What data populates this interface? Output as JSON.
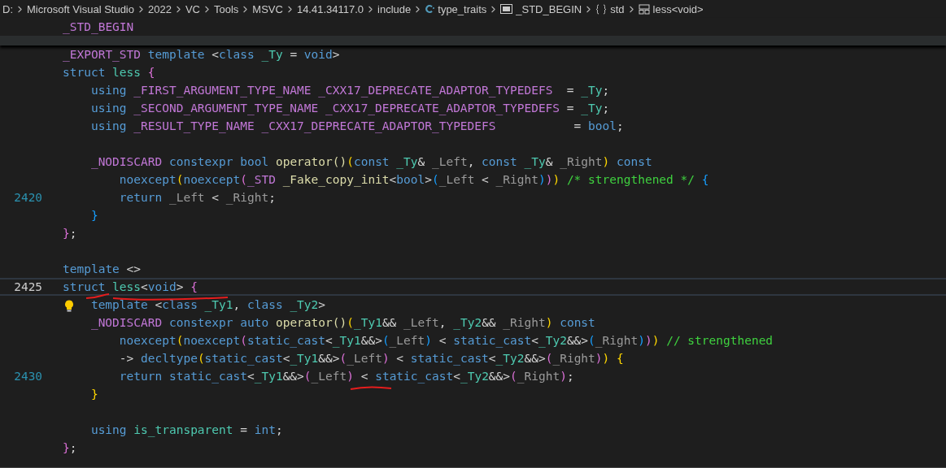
{
  "breadcrumb": [
    {
      "kind": "folder",
      "label": "D:"
    },
    {
      "kind": "folder",
      "label": "Microsoft Visual Studio"
    },
    {
      "kind": "folder",
      "label": "2022"
    },
    {
      "kind": "folder",
      "label": "VC"
    },
    {
      "kind": "folder",
      "label": "Tools"
    },
    {
      "kind": "folder",
      "label": "MSVC"
    },
    {
      "kind": "folder",
      "label": "14.41.34117.0"
    },
    {
      "kind": "folder",
      "label": "include"
    },
    {
      "kind": "file",
      "label": "type_traits"
    },
    {
      "kind": "macro",
      "label": "_STD_BEGIN"
    },
    {
      "kind": "namespace",
      "label": "std"
    },
    {
      "kind": "struct",
      "label": "less<void>"
    }
  ],
  "sticky_lines": [
    {
      "tokens": [
        {
          "kind": "macro",
          "text": "_STD_BEGIN"
        }
      ]
    }
  ],
  "lines": [
    {
      "current": false,
      "tokens": [
        {
          "kind": "macro",
          "text": "_EXPORT_STD"
        },
        {
          "kind": "kw",
          "text": " template"
        },
        {
          "kind": "plain",
          "text": " <"
        },
        {
          "kind": "kw",
          "text": "class"
        },
        {
          "kind": "type",
          "text": " _Ty"
        },
        {
          "kind": "plain",
          "text": " ="
        },
        {
          "kind": "kw",
          "text": " void"
        },
        {
          "kind": "plain",
          "text": ">"
        }
      ]
    },
    {
      "current": false,
      "tokens": [
        {
          "kind": "kw",
          "text": "struct"
        },
        {
          "kind": "type",
          "text": " less"
        },
        {
          "kind": "b2",
          "text": " {"
        }
      ]
    },
    {
      "current": false,
      "tokens": [
        {
          "kind": "kw",
          "text": "    using"
        },
        {
          "kind": "macro",
          "text": " _FIRST_ARGUMENT_TYPE_NAME"
        },
        {
          "kind": "macro",
          "text": " _CXX17_DEPRECATE_ADAPTOR_TYPEDEFS"
        },
        {
          "kind": "plain",
          "text": "  ="
        },
        {
          "kind": "type",
          "text": " _Ty"
        },
        {
          "kind": "plain",
          "text": ";"
        }
      ]
    },
    {
      "current": false,
      "tokens": [
        {
          "kind": "kw",
          "text": "    using"
        },
        {
          "kind": "macro",
          "text": " _SECOND_ARGUMENT_TYPE_NAME"
        },
        {
          "kind": "macro",
          "text": " _CXX17_DEPRECATE_ADAPTOR_TYPEDEFS"
        },
        {
          "kind": "plain",
          "text": " ="
        },
        {
          "kind": "type",
          "text": " _Ty"
        },
        {
          "kind": "plain",
          "text": ";"
        }
      ]
    },
    {
      "current": false,
      "tokens": [
        {
          "kind": "kw",
          "text": "    using"
        },
        {
          "kind": "macro",
          "text": " _RESULT_TYPE_NAME"
        },
        {
          "kind": "macro",
          "text": " _CXX17_DEPRECATE_ADAPTOR_TYPEDEFS"
        },
        {
          "kind": "plain",
          "text": "           ="
        },
        {
          "kind": "kw",
          "text": " bool"
        },
        {
          "kind": "plain",
          "text": ";"
        }
      ]
    },
    {
      "current": false
    },
    {
      "current": false,
      "tokens": [
        {
          "kind": "macro",
          "text": "    _NODISCARD"
        },
        {
          "kind": "kw",
          "text": " constexpr"
        },
        {
          "kind": "kw",
          "text": " bool"
        },
        {
          "kind": "fn",
          "text": " operator()"
        },
        {
          "kind": "b1",
          "text": "("
        },
        {
          "kind": "kw",
          "text": "const"
        },
        {
          "kind": "type",
          "text": " _Ty"
        },
        {
          "kind": "plain",
          "text": "&"
        },
        {
          "kind": "param",
          "text": " _Left"
        },
        {
          "kind": "plain",
          "text": ","
        },
        {
          "kind": "kw",
          "text": " const"
        },
        {
          "kind": "type",
          "text": " _Ty"
        },
        {
          "kind": "plain",
          "text": "&"
        },
        {
          "kind": "param",
          "text": " _Right"
        },
        {
          "kind": "b1",
          "text": ")"
        },
        {
          "kind": "kw",
          "text": " const"
        }
      ]
    },
    {
      "current": false,
      "tokens": [
        {
          "kind": "kw",
          "text": "        noexcept"
        },
        {
          "kind": "b1",
          "text": "("
        },
        {
          "kind": "kw",
          "text": "noexcept"
        },
        {
          "kind": "b2",
          "text": "("
        },
        {
          "kind": "macro",
          "text": "_STD"
        },
        {
          "kind": "fn",
          "text": " _Fake_copy_init"
        },
        {
          "kind": "plain",
          "text": "<"
        },
        {
          "kind": "kw",
          "text": "bool"
        },
        {
          "kind": "plain",
          "text": ">"
        },
        {
          "kind": "b3",
          "text": "("
        },
        {
          "kind": "param",
          "text": "_Left"
        },
        {
          "kind": "plain",
          "text": " <"
        },
        {
          "kind": "param",
          "text": " _Right"
        },
        {
          "kind": "b3",
          "text": ")"
        },
        {
          "kind": "b2",
          "text": ")"
        },
        {
          "kind": "b1",
          "text": ")"
        },
        {
          "kind": "comment",
          "text": " /* strengthened */"
        },
        {
          "kind": "b3",
          "text": " {"
        }
      ]
    },
    {
      "current": false,
      "number": "2420",
      "tokens": [
        {
          "kind": "kw",
          "text": "        return"
        },
        {
          "kind": "param",
          "text": " _Left"
        },
        {
          "kind": "plain",
          "text": " <"
        },
        {
          "kind": "param",
          "text": " _Right"
        },
        {
          "kind": "plain",
          "text": ";"
        }
      ]
    },
    {
      "current": false,
      "tokens": [
        {
          "kind": "b3",
          "text": "    }"
        }
      ]
    },
    {
      "current": false,
      "tokens": [
        {
          "kind": "b2",
          "text": "}"
        },
        {
          "kind": "plain",
          "text": ";"
        }
      ]
    },
    {
      "current": false
    },
    {
      "current": false,
      "tokens": [
        {
          "kind": "kw",
          "text": "template"
        },
        {
          "kind": "plain",
          "text": " <>"
        }
      ]
    },
    {
      "current": true,
      "number": "2425",
      "tokens": [
        {
          "kind": "kw",
          "text": "struct"
        },
        {
          "kind": "type",
          "text": " less"
        },
        {
          "kind": "plain",
          "text": "<"
        },
        {
          "kind": "kw",
          "text": "void"
        },
        {
          "kind": "plain",
          "text": ">"
        },
        {
          "kind": "b2",
          "text": " {"
        }
      ]
    },
    {
      "current": false,
      "lightbulb": true,
      "tokens": [
        {
          "kind": "kw",
          "text": "    template"
        },
        {
          "kind": "plain",
          "text": " <"
        },
        {
          "kind": "kw",
          "text": "class"
        },
        {
          "kind": "type",
          "text": " _Ty1"
        },
        {
          "kind": "plain",
          "text": ","
        },
        {
          "kind": "kw",
          "text": " class"
        },
        {
          "kind": "type",
          "text": " _Ty2"
        },
        {
          "kind": "plain",
          "text": ">"
        }
      ]
    },
    {
      "current": false,
      "tokens": [
        {
          "kind": "macro",
          "text": "    _NODISCARD"
        },
        {
          "kind": "kw",
          "text": " constexpr"
        },
        {
          "kind": "kw",
          "text": " auto"
        },
        {
          "kind": "fn",
          "text": " operator()"
        },
        {
          "kind": "b1",
          "text": "("
        },
        {
          "kind": "type",
          "text": "_Ty1"
        },
        {
          "kind": "plain",
          "text": "&&"
        },
        {
          "kind": "param",
          "text": " _Left"
        },
        {
          "kind": "plain",
          "text": ","
        },
        {
          "kind": "type",
          "text": " _Ty2"
        },
        {
          "kind": "plain",
          "text": "&&"
        },
        {
          "kind": "param",
          "text": " _Right"
        },
        {
          "kind": "b1",
          "text": ")"
        },
        {
          "kind": "kw",
          "text": " const"
        }
      ]
    },
    {
      "current": false,
      "tokens": [
        {
          "kind": "kw",
          "text": "        noexcept"
        },
        {
          "kind": "b1",
          "text": "("
        },
        {
          "kind": "kw",
          "text": "noexcept"
        },
        {
          "kind": "b2",
          "text": "("
        },
        {
          "kind": "kw",
          "text": "static_cast"
        },
        {
          "kind": "plain",
          "text": "<"
        },
        {
          "kind": "type",
          "text": "_Ty1"
        },
        {
          "kind": "plain",
          "text": "&&>"
        },
        {
          "kind": "b3",
          "text": "("
        },
        {
          "kind": "param",
          "text": "_Left"
        },
        {
          "kind": "b3",
          "text": ")"
        },
        {
          "kind": "plain",
          "text": " <"
        },
        {
          "kind": "kw",
          "text": " static_cast"
        },
        {
          "kind": "plain",
          "text": "<"
        },
        {
          "kind": "type",
          "text": "_Ty2"
        },
        {
          "kind": "plain",
          "text": "&&>"
        },
        {
          "kind": "b3",
          "text": "("
        },
        {
          "kind": "param",
          "text": "_Right"
        },
        {
          "kind": "b3",
          "text": ")"
        },
        {
          "kind": "b2",
          "text": ")"
        },
        {
          "kind": "b1",
          "text": ")"
        },
        {
          "kind": "comment",
          "text": " // strengthened"
        }
      ]
    },
    {
      "current": false,
      "tokens": [
        {
          "kind": "plain",
          "text": "        ->"
        },
        {
          "kind": "kw",
          "text": " decltype"
        },
        {
          "kind": "b1",
          "text": "("
        },
        {
          "kind": "kw",
          "text": "static_cast"
        },
        {
          "kind": "plain",
          "text": "<"
        },
        {
          "kind": "type",
          "text": "_Ty1"
        },
        {
          "kind": "plain",
          "text": "&&>"
        },
        {
          "kind": "b2",
          "text": "("
        },
        {
          "kind": "param",
          "text": "_Left"
        },
        {
          "kind": "b2",
          "text": ")"
        },
        {
          "kind": "plain",
          "text": " <"
        },
        {
          "kind": "kw",
          "text": " static_cast"
        },
        {
          "kind": "plain",
          "text": "<"
        },
        {
          "kind": "type",
          "text": "_Ty2"
        },
        {
          "kind": "plain",
          "text": "&&>"
        },
        {
          "kind": "b2",
          "text": "("
        },
        {
          "kind": "param",
          "text": "_Right"
        },
        {
          "kind": "b2",
          "text": ")"
        },
        {
          "kind": "b1",
          "text": ")"
        },
        {
          "kind": "b1",
          "text": " {"
        }
      ]
    },
    {
      "current": false,
      "number": "2430",
      "tokens": [
        {
          "kind": "kw",
          "text": "        return"
        },
        {
          "kind": "kw",
          "text": " static_cast"
        },
        {
          "kind": "plain",
          "text": "<"
        },
        {
          "kind": "type",
          "text": "_Ty1"
        },
        {
          "kind": "plain",
          "text": "&&>"
        },
        {
          "kind": "b2",
          "text": "("
        },
        {
          "kind": "param",
          "text": "_Left"
        },
        {
          "kind": "b2",
          "text": ")"
        },
        {
          "kind": "plain",
          "text": " <"
        },
        {
          "kind": "kw",
          "text": " static_cast"
        },
        {
          "kind": "plain",
          "text": "<"
        },
        {
          "kind": "type",
          "text": "_Ty2"
        },
        {
          "kind": "plain",
          "text": "&&>"
        },
        {
          "kind": "b2",
          "text": "("
        },
        {
          "kind": "param",
          "text": "_Right"
        },
        {
          "kind": "b2",
          "text": ")"
        },
        {
          "kind": "plain",
          "text": ";"
        }
      ]
    },
    {
      "current": false,
      "tokens": [
        {
          "kind": "b1",
          "text": "    }"
        }
      ]
    },
    {
      "current": false
    },
    {
      "current": false,
      "tokens": [
        {
          "kind": "kw",
          "text": "    using"
        },
        {
          "kind": "type",
          "text": " is_transparent"
        },
        {
          "kind": "plain",
          "text": " ="
        },
        {
          "kind": "kw",
          "text": " int"
        },
        {
          "kind": "plain",
          "text": ";"
        }
      ]
    },
    {
      "current": false,
      "tokens": [
        {
          "kind": "b2",
          "text": "}"
        },
        {
          "kind": "plain",
          "text": ";"
        }
      ]
    }
  ]
}
